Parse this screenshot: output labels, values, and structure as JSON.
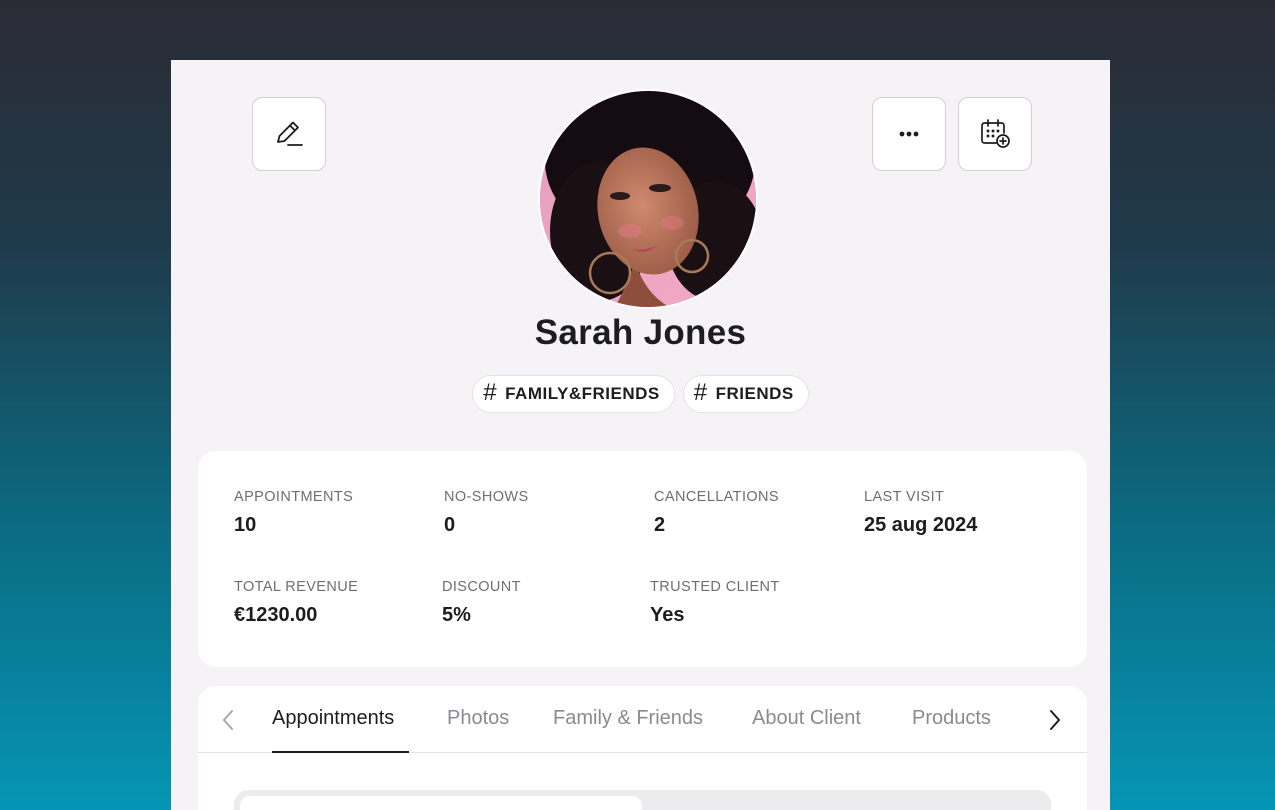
{
  "header": {
    "edit_icon": "pencil-edit-icon",
    "more_icon": "more-dots-icon",
    "calendar_icon": "calendar-add-icon"
  },
  "client": {
    "name": "Sarah Jones",
    "avatar": "client-portrait-photo",
    "tags": [
      "FAMILY&FRIENDS",
      "FRIENDS"
    ]
  },
  "stats": {
    "appointments": {
      "label": "APPOINTMENTS",
      "value": "10"
    },
    "no_shows": {
      "label": "NO-SHOWS",
      "value": "0"
    },
    "cancellations": {
      "label": "CANCELLATIONS",
      "value": "2"
    },
    "last_visit": {
      "label": "LAST VISIT",
      "value": "25 aug 2024"
    },
    "total_revenue": {
      "label": "TOTAL REVENUE",
      "value": "€1230.00"
    },
    "discount": {
      "label": "DISCOUNT",
      "value": "5%"
    },
    "trusted_client": {
      "label": "TRUSTED CLIENT",
      "value": "Yes"
    }
  },
  "tabs": {
    "items": [
      "Appointments",
      "Photos",
      "Family & Friends",
      "About Client",
      "Products"
    ],
    "active": "Appointments"
  },
  "colors": {
    "text": "#1d1d1f",
    "muted": "#8a8a90",
    "panel": "#f5f3f6"
  }
}
